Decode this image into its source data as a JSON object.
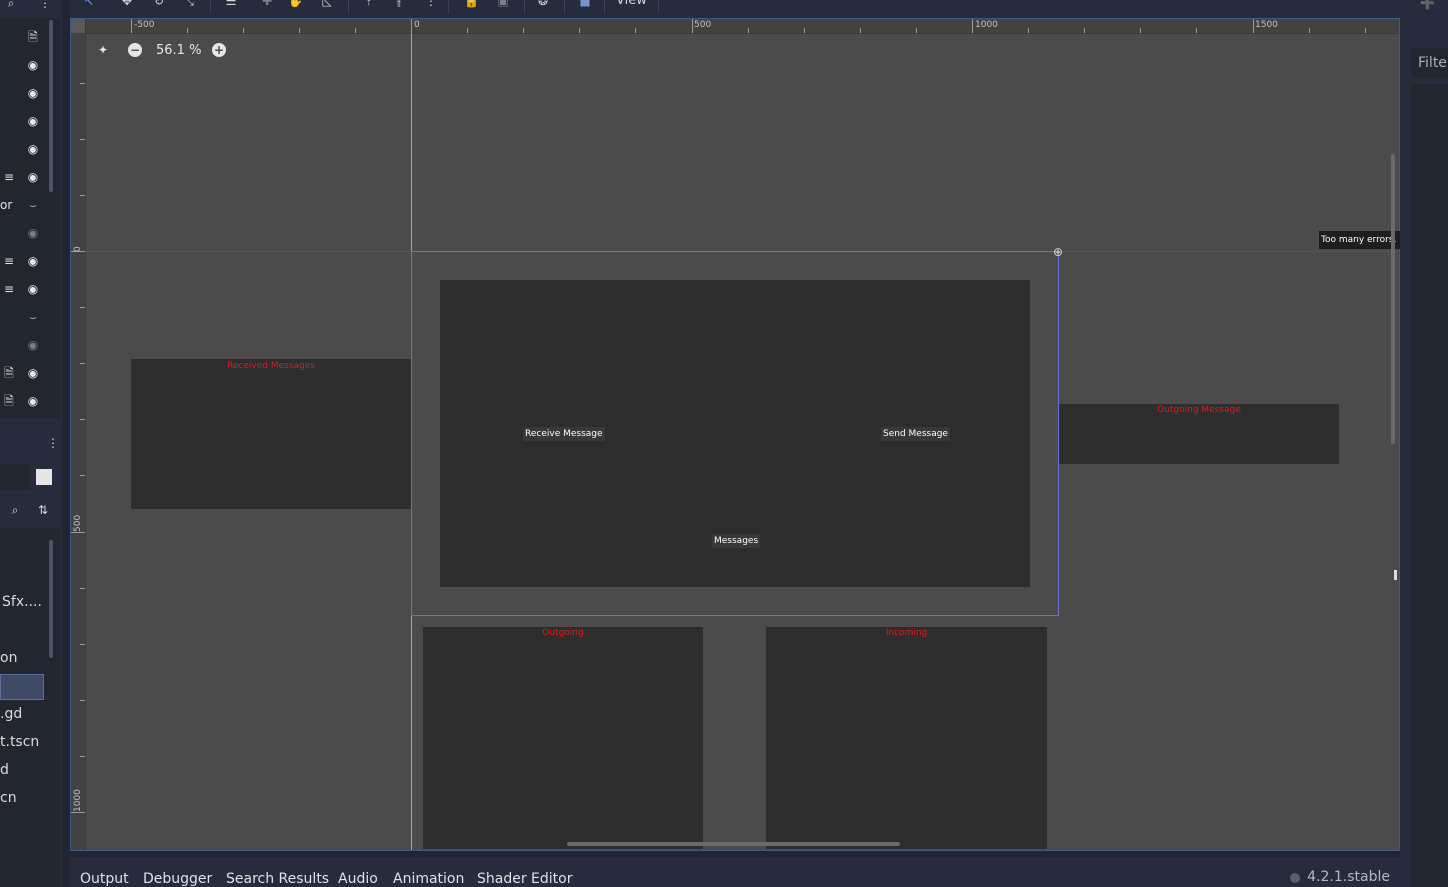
{
  "viewport": {
    "zoom_label": "56.1 %",
    "ruler_top_labels": [
      "-500",
      "0",
      "500",
      "1000",
      "1500"
    ],
    "ruler_left_labels": [
      "0",
      "500",
      "1000"
    ],
    "error_toast": "Too many errors, r"
  },
  "panels": {
    "received": "Received Messages",
    "outgoing_message": "Outgoing Message",
    "outgoing": "Outgoing",
    "incoming": "Incoming"
  },
  "buttons": {
    "receive": "Receive Message",
    "send": "Send Message",
    "messages": "Messages"
  },
  "toolbar": {
    "view_menu": "View"
  },
  "right_dock": {
    "filter_text": "Filter"
  },
  "left_dock": {
    "tree_partial": "or",
    "fs_items": [
      "Sfx....",
      "on",
      ".gd",
      "t.tscn",
      "d",
      "cn"
    ]
  },
  "bottom_tabs": [
    "Output",
    "Debugger",
    "Search Results",
    "Audio",
    "Animation",
    "Shader Editor"
  ],
  "version": "4.2.1.stable",
  "colors": {
    "editor_bg": "#202531",
    "panel_bg": "#2d2d2d",
    "panel_title": "#e21b1b",
    "x_axis": "#c2243c",
    "y_axis": "#9bc21f",
    "selection_outline": "#6a6fd4"
  }
}
